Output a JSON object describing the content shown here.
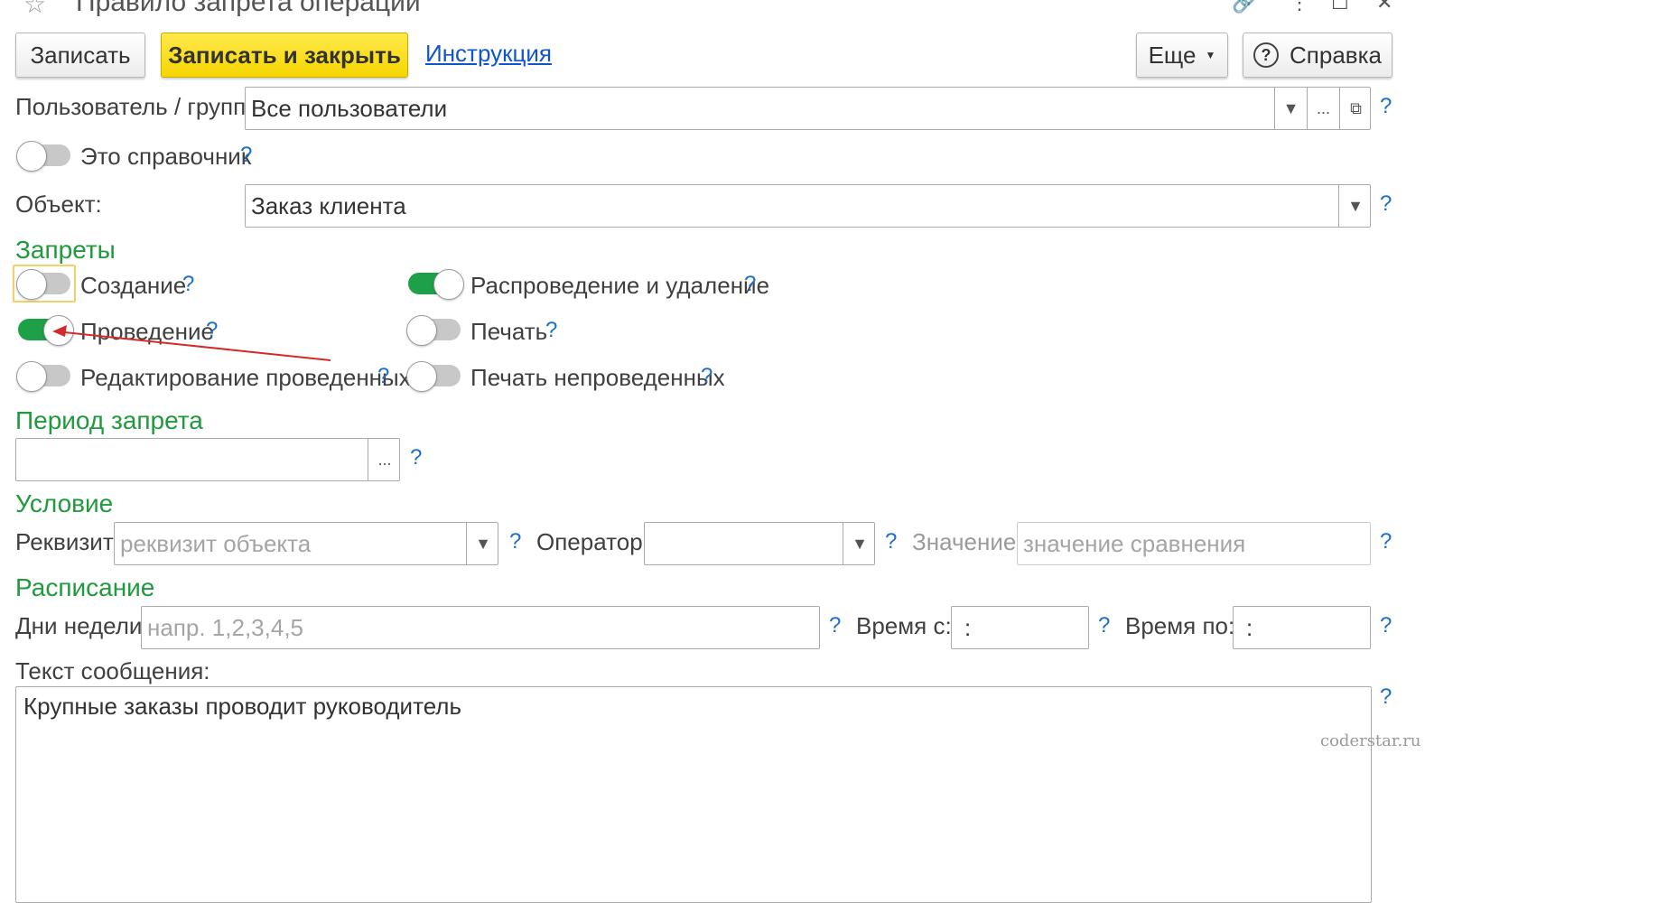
{
  "window": {
    "title": "Правило запрета операции"
  },
  "toolbar": {
    "save_label": "Записать",
    "save_close_label": "Записать и закрыть",
    "instruction_link": "Инструкция",
    "more_label": "Еще",
    "help_label": "Справка"
  },
  "user_group": {
    "label": "Пользователь / группа:",
    "value": "Все пользователи",
    "help": "?"
  },
  "is_catalog": {
    "label": "Это справочник",
    "checked": false,
    "help": "?"
  },
  "object": {
    "label": "Объект:",
    "value": "Заказ клиента",
    "help": "?"
  },
  "bans": {
    "heading": "Запреты",
    "items": [
      {
        "label": "Создание",
        "checked": false,
        "help": "?"
      },
      {
        "label": "Проведение",
        "checked": true,
        "help": "?"
      },
      {
        "label": "Редактирование проведенных",
        "checked": false,
        "help": "?"
      },
      {
        "label": "Распроведение и удаление",
        "checked": true,
        "help": "?"
      },
      {
        "label": "Печать",
        "checked": false,
        "help": "?"
      },
      {
        "label": "Печать непроведенных",
        "checked": false,
        "help": "?"
      }
    ]
  },
  "period": {
    "heading": "Период запрета",
    "value": "",
    "select_button": "...",
    "help": "?"
  },
  "condition": {
    "heading": "Условие",
    "attribute_label": "Реквизит:",
    "attribute_placeholder": "реквизит объекта",
    "operator_label": "Оператор:",
    "operator_value": "",
    "value_label": "Значение:",
    "value_placeholder": "значение сравнения",
    "help": "?"
  },
  "schedule": {
    "heading": "Расписание",
    "days_label": "Дни недели:",
    "days_placeholder": "напр. 1,2,3,4,5",
    "time_from_label": "Время с:",
    "time_from_value": " :",
    "time_to_label": "Время по:",
    "time_to_value": " :",
    "help": "?"
  },
  "message": {
    "label": "Текст сообщения:",
    "value": "Крупные заказы проводит руководитель",
    "help": "?"
  },
  "watermark": "coderstar.ru",
  "icons": {
    "star": "star-icon",
    "link": "link-icon",
    "menu": "kebab-menu-icon",
    "maximize": "maximize-icon",
    "close": "close-icon",
    "help": "question-circle-icon",
    "dropdown": "chevron-down-icon",
    "open": "open-window-icon"
  },
  "colors": {
    "primary_button": "#f6d600",
    "section_heading": "#1f9a3c",
    "toggle_on": "#1ea048",
    "help": "#1e6fc7",
    "annotation_arrow": "#d42a2a"
  }
}
